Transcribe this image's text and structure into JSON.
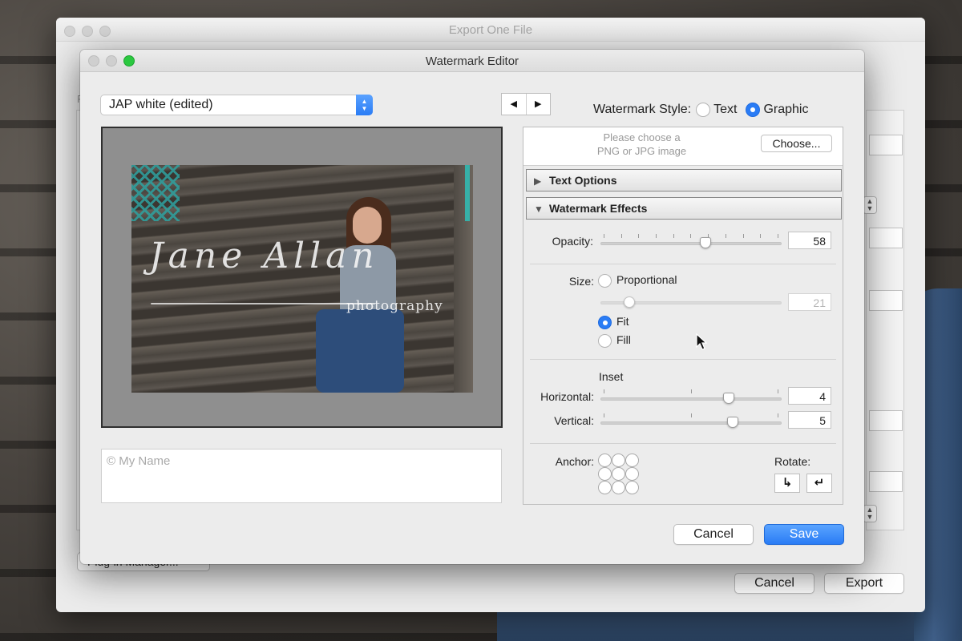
{
  "export_window": {
    "title": "Export One File",
    "left_label": "P",
    "plugin_manager_label": "Plug-in Manager...",
    "cancel_label": "Cancel",
    "export_label": "Export"
  },
  "watermark_editor": {
    "title": "Watermark Editor",
    "preset": "JAP white (edited)",
    "nav_prev": "◀",
    "nav_next": "▶",
    "style_label": "Watermark Style:",
    "style_options": [
      "Text",
      "Graphic"
    ],
    "style_selected": "Graphic",
    "preview": {
      "watermark_text": "Jane Allan",
      "watermark_sub": "photography"
    },
    "text_placeholder": "© My Name",
    "choose": {
      "hint_line1": "Please choose a",
      "hint_line2": "PNG or JPG image",
      "button": "Choose..."
    },
    "sections": {
      "text_options": "Text Options",
      "watermark_effects": "Watermark Effects"
    },
    "opacity": {
      "label": "Opacity:",
      "value": "58",
      "level": 0.58
    },
    "size": {
      "label": "Size:",
      "options": [
        "Proportional",
        "Fit",
        "Fill"
      ],
      "selected": "Fit",
      "proportional_value": "21",
      "proportional_level": 0.16
    },
    "inset": {
      "label": "Inset",
      "horizontal_label": "Horizontal:",
      "horizontal_value": "4",
      "horizontal_level": 0.71,
      "vertical_label": "Vertical:",
      "vertical_value": "5",
      "vertical_level": 0.73
    },
    "anchor_label": "Anchor:",
    "rotate_label": "Rotate:",
    "rotate_cw": "↳",
    "rotate_ccw": "↵",
    "cancel_label": "Cancel",
    "save_label": "Save"
  },
  "colors": {
    "accent": "#2a7cf5",
    "traffic_green": "#2bc840"
  }
}
